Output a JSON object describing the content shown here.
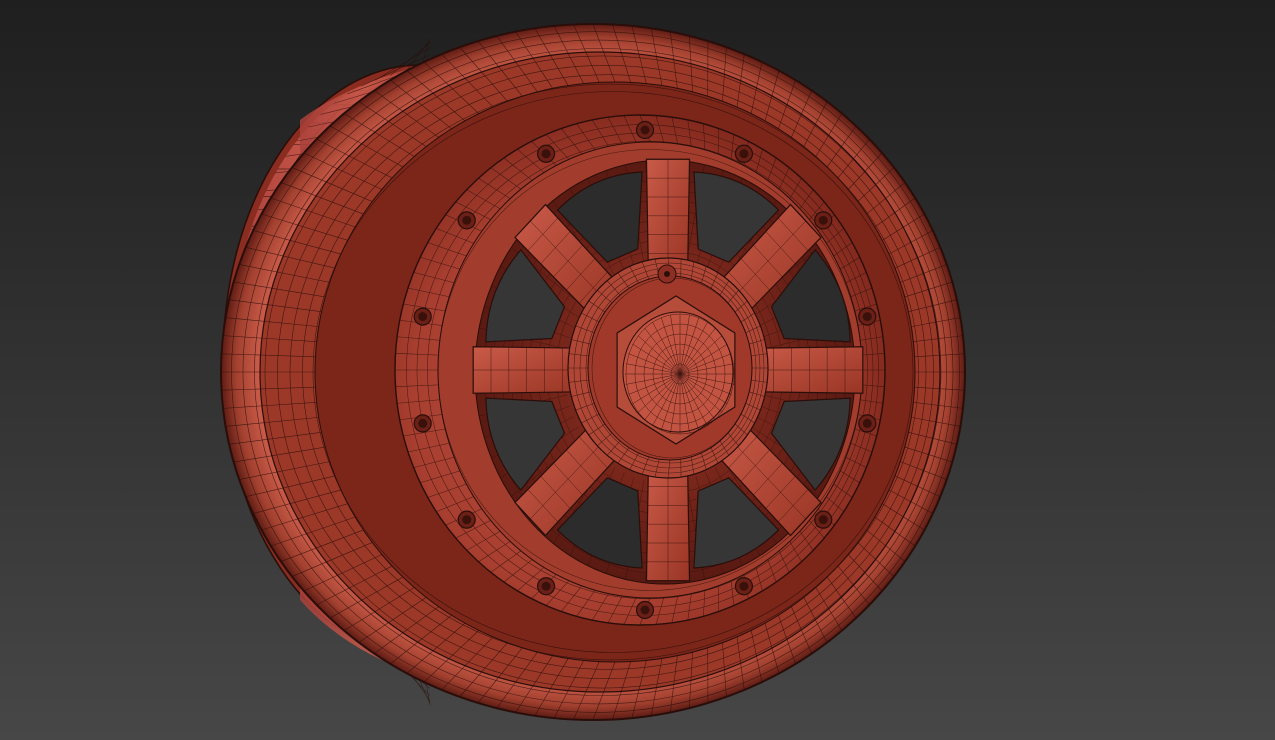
{
  "viewport": {
    "background_top": "#1f1f1f",
    "background_bottom": "#474747"
  },
  "model": {
    "name": "beadlock-wheel-rim",
    "render_mode": "shaded-with-wireframe",
    "spoke_count": 8,
    "beadlock_bolt_count": 14,
    "colors": {
      "base": "#b8493a",
      "highlight": "#d4624f",
      "shadow": "#5e1c14",
      "wire": "#2a0e0a"
    }
  }
}
